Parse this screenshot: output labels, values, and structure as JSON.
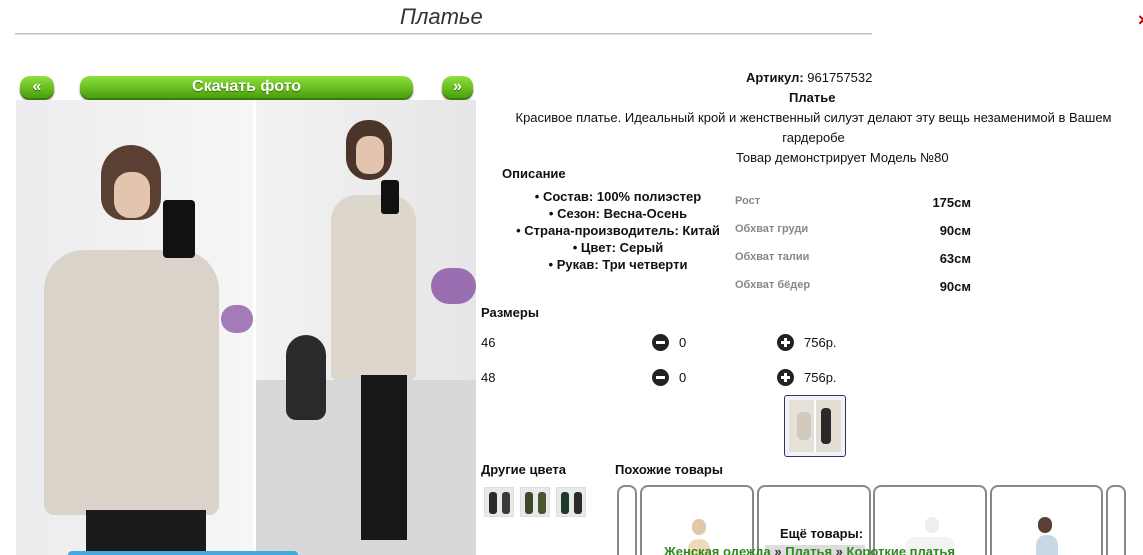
{
  "page": {
    "title": "Платье",
    "close_glyph": "×"
  },
  "gallery": {
    "prev_label": "«",
    "download_label": "Скачать фото",
    "next_label": "»"
  },
  "product": {
    "article_label": "Артикул:",
    "article_value": "961757532",
    "name": "Платье",
    "description": "Красивое платье. Идеальный крой и женственный силуэт делают эту вещь незаменимой в Вашем гардеробе",
    "model_line": "Товар демонстрирует Модель №80"
  },
  "specs": {
    "title": "Описание",
    "items": [
      "Состав: 100% полиэстер",
      "Сезон: Весна-Осень",
      "Страна-производитель: Китай",
      "Цвет: Серый",
      "Рукав: Три четверти"
    ]
  },
  "measurements": [
    {
      "label": "Рост",
      "value": "175см"
    },
    {
      "label": "Обхват груди",
      "value": "90см"
    },
    {
      "label": "Обхват талии",
      "value": "63см"
    },
    {
      "label": "Обхват бёдер",
      "value": "90см"
    }
  ],
  "sizes": {
    "title": "Размеры",
    "rows": [
      {
        "size": "46",
        "qty": "0",
        "price": "756р."
      },
      {
        "size": "48",
        "qty": "0",
        "price": "756р."
      }
    ]
  },
  "other_colors": {
    "title": "Другие цвета"
  },
  "similar": {
    "title": "Похожие товары"
  },
  "more": {
    "title": "Ещё товары:"
  },
  "breadcrumb": {
    "items": [
      "Женская одежда",
      "Платья",
      "Короткие платья"
    ],
    "separator": "»"
  },
  "colors": {
    "button_green": "#5cb81a",
    "breadcrumb_green": "#2f8a1e",
    "close_red": "#cc0000"
  }
}
